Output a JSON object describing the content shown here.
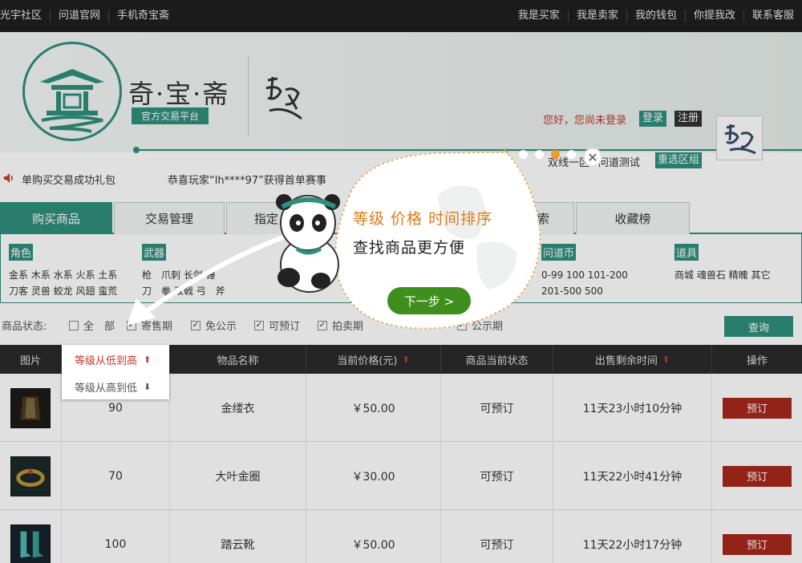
{
  "topbar": {
    "left": [
      "光宇社区",
      "问道官网",
      "手机奇宝斋"
    ],
    "right": [
      "我是买家",
      "我是卖家",
      "我的钱包",
      "你提我改",
      "联系客服"
    ]
  },
  "header": {
    "brand": "奇·宝·斋",
    "sub": "官方交易平台",
    "login_msg": "您好，您尚未登录",
    "login": "登录",
    "register": "注册",
    "server": "双线一区→问道测试",
    "reselect": "重选区组"
  },
  "notice": {
    "left": "单购买交易成功礼包",
    "right": "恭喜玩家“lh****97”获得首单赛事"
  },
  "tabs": [
    "购买商品",
    "交易管理",
    "指定",
    "索",
    "收藏榜"
  ],
  "categories": [
    {
      "tag": "角色",
      "lines": [
        "金系 木系 水系 火系 土系",
        "刀客 灵兽 蛟龙 风翅 蛮荒"
      ]
    },
    {
      "tag": "武器",
      "lines": [
        "枪　爪刺 长剑 锤",
        "刀　拳 双戟 弓　斧"
      ]
    },
    {
      "tag": "问道币",
      "lines": [
        "0-99  100  101-200",
        "201-500  500"
      ]
    },
    {
      "tag": "道具",
      "lines": [
        "商城 魂兽石 精魄 其它"
      ]
    }
  ],
  "filter": {
    "label": "商品状态:",
    "options": [
      {
        "label": "全　部",
        "checked": false
      },
      {
        "label": "寄售期",
        "checked": true
      },
      {
        "label": "免公示",
        "checked": true
      },
      {
        "label": "可预订",
        "checked": true
      },
      {
        "label": "拍卖期",
        "checked": true
      },
      {
        "label": "公示期",
        "checked": true
      }
    ],
    "query": "查询"
  },
  "table": {
    "headers": [
      "图片",
      "等级",
      "物品名称",
      "当前价格(元)",
      "商品当前状态",
      "出售剩余时间",
      "操作"
    ],
    "rows": [
      {
        "level": "90",
        "name": "金缕衣",
        "price": "￥50.00",
        "status": "可预订",
        "remaining": "11天23小时10分钟",
        "action": "预订"
      },
      {
        "level": "70",
        "name": "大叶金圈",
        "price": "￥30.00",
        "status": "可预订",
        "remaining": "11天22小时41分钟",
        "action": "预订"
      },
      {
        "level": "100",
        "name": "踏云靴",
        "price": "￥50.00",
        "status": "可预订",
        "remaining": "11天22小时17分钟",
        "action": "预订"
      }
    ]
  },
  "sort_menu": {
    "asc": "等级从低到高",
    "desc": "等级从高到低"
  },
  "guide": {
    "line1": "等级 价格 时间排序",
    "line2": "查找商品更方便",
    "next": "下一步 >",
    "current_step": 3,
    "total_steps": 4
  },
  "colors": {
    "accent": "#2f8f7c",
    "topbar": "#1b1b1b",
    "book_button": "#a8281d",
    "guide_orange": "#e07a18",
    "next_button": "#3f8f1f"
  }
}
